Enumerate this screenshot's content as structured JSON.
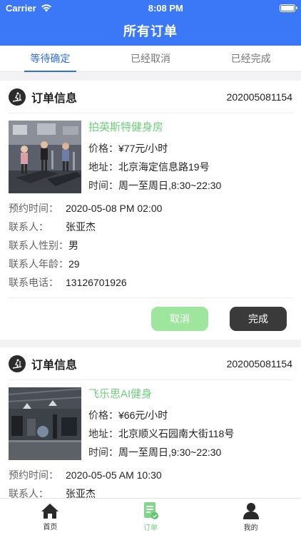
{
  "status_bar": {
    "carrier": "Carrier",
    "time": "8:08 PM"
  },
  "header": {
    "title": "所有订单"
  },
  "tabs": [
    {
      "label": "等待确定",
      "active": true
    },
    {
      "label": "已经取消",
      "active": false
    },
    {
      "label": "已经完成",
      "active": false
    }
  ],
  "orders": [
    {
      "section_label": "订单信息",
      "order_no": "202005081154",
      "venue_name": "拍英斯特健身房",
      "price_label": "价格：",
      "price": "¥77元/小时",
      "address_label": "地址：",
      "address": "北京海定信息路19号",
      "hours_label": "时间：",
      "hours": "周一至周日,8:30~22:30",
      "booking_label": "预约时间：",
      "booking_time": "2020-05-08 PM 02:00",
      "contact_label": "联系人：",
      "contact": "张亚杰",
      "gender_label": "联系人性别：",
      "gender": "男",
      "age_label": "联系人年龄：",
      "age": "29",
      "phone_label": "联系电话：",
      "phone": "13126701926",
      "cancel_label": "取消",
      "done_label": "完成"
    },
    {
      "section_label": "订单信息",
      "order_no": "202005081154",
      "venue_name": "飞乐思AI健身",
      "price_label": "价格：",
      "price": "¥66元/小时",
      "address_label": "地址：",
      "address": "北京顺义石园南大街118号",
      "hours_label": "时间：",
      "hours": "周一至周日,9:30~22:30",
      "booking_label": "预约时间：",
      "booking_time": "2020-05-05 AM 10:30",
      "contact_label": "联系人：",
      "contact": "张亚杰"
    }
  ],
  "tabbar": [
    {
      "label": "首页",
      "icon": "home-icon",
      "active": false
    },
    {
      "label": "订单",
      "icon": "order-icon",
      "active": true
    },
    {
      "label": "我的",
      "icon": "profile-icon",
      "active": false
    }
  ],
  "colors": {
    "primary": "#3a78f7",
    "accent_green": "#6ed07a",
    "tab_blue": "#2f6fe6",
    "done_button": "#3a3a3a",
    "cancel_button": "#9ee69d"
  }
}
